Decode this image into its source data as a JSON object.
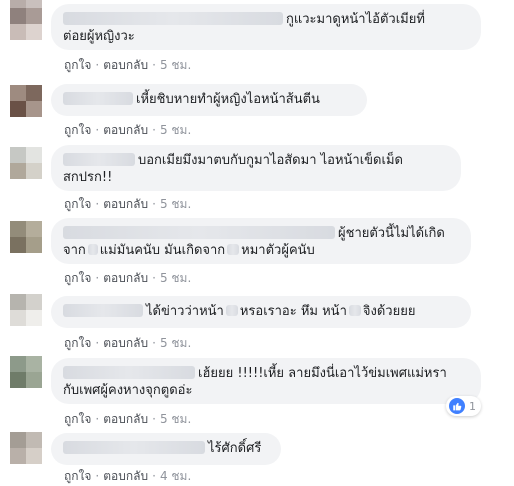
{
  "comments": [
    {
      "lines": [
        "กูแวะมาดูหน้าไอ้ตัวเมียที่",
        "ต่อยผู้หญิงวะ"
      ],
      "like_label": "ถูกใจ",
      "reply_label": "ตอบกลับ",
      "time": "5 ชม."
    },
    {
      "lines": [
        "เหี้ยชิบหายทำผู้หญิงไอหน้าส้นตีน"
      ],
      "like_label": "ถูกใจ",
      "reply_label": "ตอบกลับ",
      "time": "5 ชม."
    },
    {
      "lines": [
        "บอกเมียมึงมาตบกับกูมาไอสัดมา ไอหน้าเข็ดเม็ด",
        "สกปรก!!"
      ],
      "like_label": "ถูกใจ",
      "reply_label": "ตอบกลับ",
      "time": "5 ชม."
    },
    {
      "lines": [
        "ผู้ชายตัวนี้ไม่ได้เกิด",
        "จาก",
        "แม่มันคนับ มันเกิดจาก",
        "หมาตัวผู้คนับ"
      ],
      "like_label": "ถูกใจ",
      "reply_label": "ตอบกลับ",
      "time": "5 ชม."
    },
    {
      "lines": [
        "ได้ข่าวว่าหน้า",
        "หรอเราอะ หึม หน้า",
        "จิงด้วยยย"
      ],
      "like_label": "ถูกใจ",
      "reply_label": "ตอบกลับ",
      "time": "5 ชม."
    },
    {
      "lines": [
        "เฮ้ยยย !!!!!เหี้ย ลายมึงนี่เอาไว้ข่มเพศแม่หรา",
        "กับเพศผู้คงหางจุกตูดอ่ะ"
      ],
      "like_label": "ถูกใจ",
      "reply_label": "ตอบกลับ",
      "time": "5 ชม.",
      "reaction_count": "1"
    },
    {
      "lines": [
        "ไร้ศักดิ์ศรี"
      ],
      "like_label": "ถูกใจ",
      "reply_label": "ตอบกลับ",
      "time": "4 ชม."
    }
  ],
  "separator": "·",
  "colors": {
    "bubble": "#f2f3f5",
    "meta_text": "#90949c",
    "action_link": "#4b4f56",
    "like_blue": "#4080ff"
  },
  "icons": {
    "reaction": "like-icon"
  }
}
